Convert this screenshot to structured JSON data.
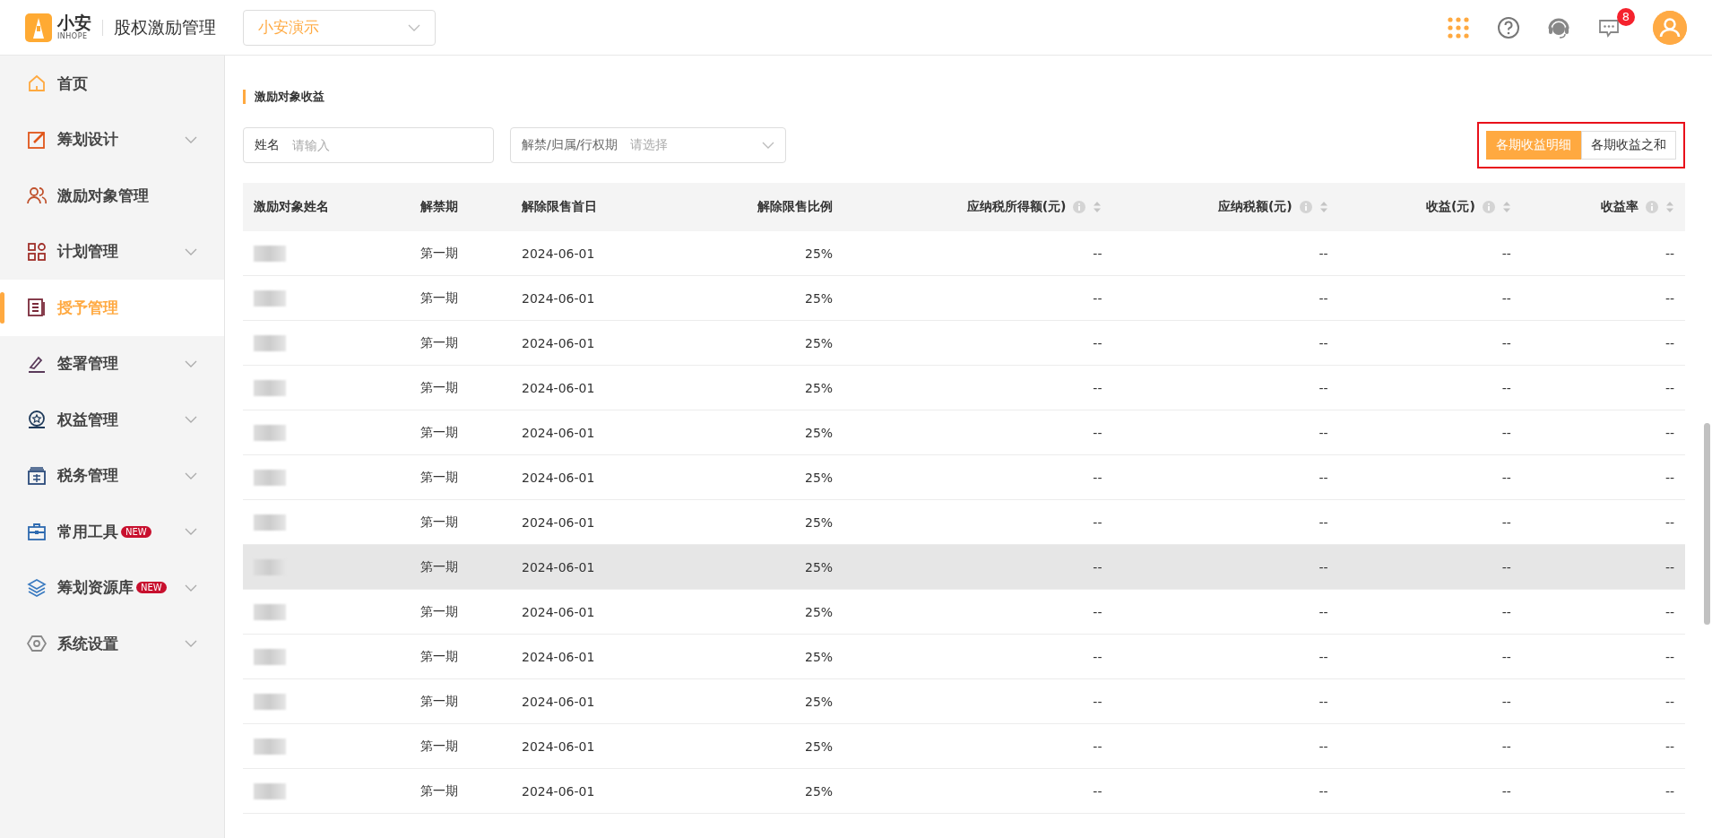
{
  "header": {
    "logo_text": "小安",
    "logo_subtext": "INHOPE",
    "app_title": "股权激励管理",
    "company_select": "小安演示",
    "notification_count": "8"
  },
  "sidebar": {
    "items": [
      {
        "label": "首页",
        "selected": false,
        "expandable": false
      },
      {
        "label": "筹划设计",
        "selected": false,
        "expandable": true
      },
      {
        "label": "激励对象管理",
        "selected": false,
        "expandable": false
      },
      {
        "label": "计划管理",
        "selected": false,
        "expandable": true
      },
      {
        "label": "授予管理",
        "selected": true,
        "expandable": false
      },
      {
        "label": "签署管理",
        "selected": false,
        "expandable": true
      },
      {
        "label": "权益管理",
        "selected": false,
        "expandable": true
      },
      {
        "label": "税务管理",
        "selected": false,
        "expandable": true
      },
      {
        "label": "常用工具",
        "selected": false,
        "expandable": true,
        "badge": "NEW"
      },
      {
        "label": "筹划资源库",
        "selected": false,
        "expandable": true,
        "badge": "NEW"
      },
      {
        "label": "系统设置",
        "selected": false,
        "expandable": true
      }
    ]
  },
  "section_title": "激励对象收益",
  "filters": [
    {
      "label": "姓名",
      "placeholder": "请输入",
      "kind": "input"
    },
    {
      "label": "解禁/归属/行权期",
      "placeholder": "请选择",
      "kind": "select"
    }
  ],
  "view_toggle": {
    "annotated": true,
    "options": [
      {
        "label": "各期收益明细",
        "selected": true
      },
      {
        "label": "各期收益之和",
        "selected": false
      }
    ]
  },
  "table": {
    "columns": [
      "激励对象姓名",
      "解禁期",
      "解除限售首日",
      "解除限售比例",
      "应纳税所得额(元)",
      "应纳税额(元)",
      "收益(元)",
      "收益率"
    ],
    "rows": [
      {
        "hovered": false,
        "cells": [
          "",
          "第一期",
          "2024-06-01",
          "25%",
          "--",
          "--",
          "--",
          "--"
        ]
      },
      {
        "hovered": false,
        "cells": [
          "",
          "第一期",
          "2024-06-01",
          "25%",
          "--",
          "--",
          "--",
          "--"
        ]
      },
      {
        "hovered": false,
        "cells": [
          "",
          "第一期",
          "2024-06-01",
          "25%",
          "--",
          "--",
          "--",
          "--"
        ]
      },
      {
        "hovered": false,
        "cells": [
          "",
          "第一期",
          "2024-06-01",
          "25%",
          "--",
          "--",
          "--",
          "--"
        ]
      },
      {
        "hovered": false,
        "cells": [
          "",
          "第一期",
          "2024-06-01",
          "25%",
          "--",
          "--",
          "--",
          "--"
        ]
      },
      {
        "hovered": false,
        "cells": [
          "",
          "第一期",
          "2024-06-01",
          "25%",
          "--",
          "--",
          "--",
          "--"
        ]
      },
      {
        "hovered": false,
        "cells": [
          "",
          "第一期",
          "2024-06-01",
          "25%",
          "--",
          "--",
          "--",
          "--"
        ]
      },
      {
        "hovered": true,
        "cells": [
          "",
          "第一期",
          "2024-06-01",
          "25%",
          "--",
          "--",
          "--",
          "--"
        ]
      },
      {
        "hovered": false,
        "cells": [
          "",
          "第一期",
          "2024-06-01",
          "25%",
          "--",
          "--",
          "--",
          "--"
        ]
      },
      {
        "hovered": false,
        "cells": [
          "",
          "第一期",
          "2024-06-01",
          "25%",
          "--",
          "--",
          "--",
          "--"
        ]
      },
      {
        "hovered": false,
        "cells": [
          "",
          "第一期",
          "2024-06-01",
          "25%",
          "--",
          "--",
          "--",
          "--"
        ]
      },
      {
        "hovered": false,
        "cells": [
          "",
          "第一期",
          "2024-06-01",
          "25%",
          "--",
          "--",
          "--",
          "--"
        ]
      },
      {
        "hovered": false,
        "cells": [
          "",
          "第一期",
          "2024-06-01",
          "25%",
          "--",
          "--",
          "--",
          "--"
        ]
      }
    ]
  }
}
